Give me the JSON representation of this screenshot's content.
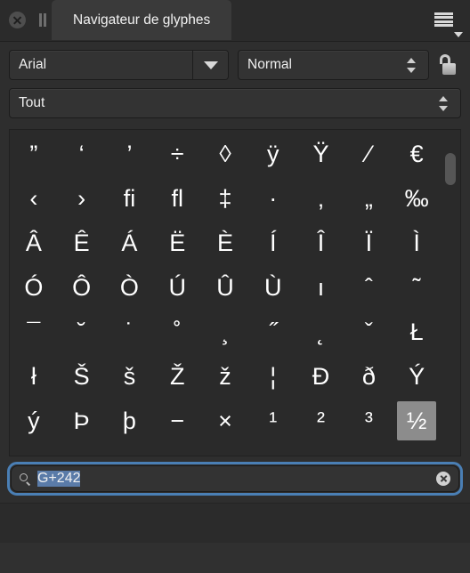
{
  "window": {
    "close_icon": "close-icon",
    "grip_icon": "grip-icon",
    "tab_title": "Navigateur de glyphes",
    "menu_icon": "hamburger-menu-icon",
    "menu_caret_icon": "chevron-down-icon"
  },
  "controls": {
    "font": {
      "label": "Arial",
      "dropdown_icon": "chevron-down-icon"
    },
    "style": {
      "label": "Normal",
      "stepper_up_icon": "chevron-up-icon",
      "stepper_down_icon": "chevron-down-icon"
    },
    "lock": {
      "icon": "unlocked-padlock-icon",
      "state": "unlocked"
    },
    "range": {
      "label": "Tout",
      "stepper_up_icon": "chevron-up-icon",
      "stepper_down_icon": "chevron-down-icon"
    }
  },
  "glyph_grid": {
    "columns": 9,
    "selected_index": 62,
    "selection_color": "#8c8c8c",
    "glyphs": [
      "”",
      "‘",
      "’",
      "÷",
      "◊",
      "ÿ",
      "Ÿ",
      "⁄",
      "€",
      "‹",
      "›",
      "ﬁ",
      "ﬂ",
      "‡",
      "·",
      "‚",
      "„",
      "‰",
      "Â",
      "Ê",
      "Á",
      "Ë",
      "È",
      "Í",
      "Î",
      "Ï",
      "Ì",
      "Ó",
      "Ô",
      "Ò",
      "Ú",
      "Û",
      "Ù",
      "ı",
      "ˆ",
      "˜",
      "¯",
      "˘",
      "˙",
      "˚",
      "¸",
      "˝",
      "˛",
      "ˇ",
      "Ł",
      "ł",
      "Š",
      "š",
      "Ž",
      "ž",
      "¦",
      "Ð",
      "ð",
      "Ý",
      "ý",
      "Þ",
      "þ",
      "−",
      "×",
      "¹",
      "²",
      "³",
      "½"
    ],
    "scrollbar": {
      "thumb_icon": "scrollbar-thumb"
    }
  },
  "search": {
    "icon": "search-icon",
    "value": "G+242",
    "value_selected": true,
    "placeholder": "",
    "clear_icon": "clear-icon",
    "focus_ring_color": "#4a7fb5",
    "selection_color": "#5a7ba8"
  }
}
